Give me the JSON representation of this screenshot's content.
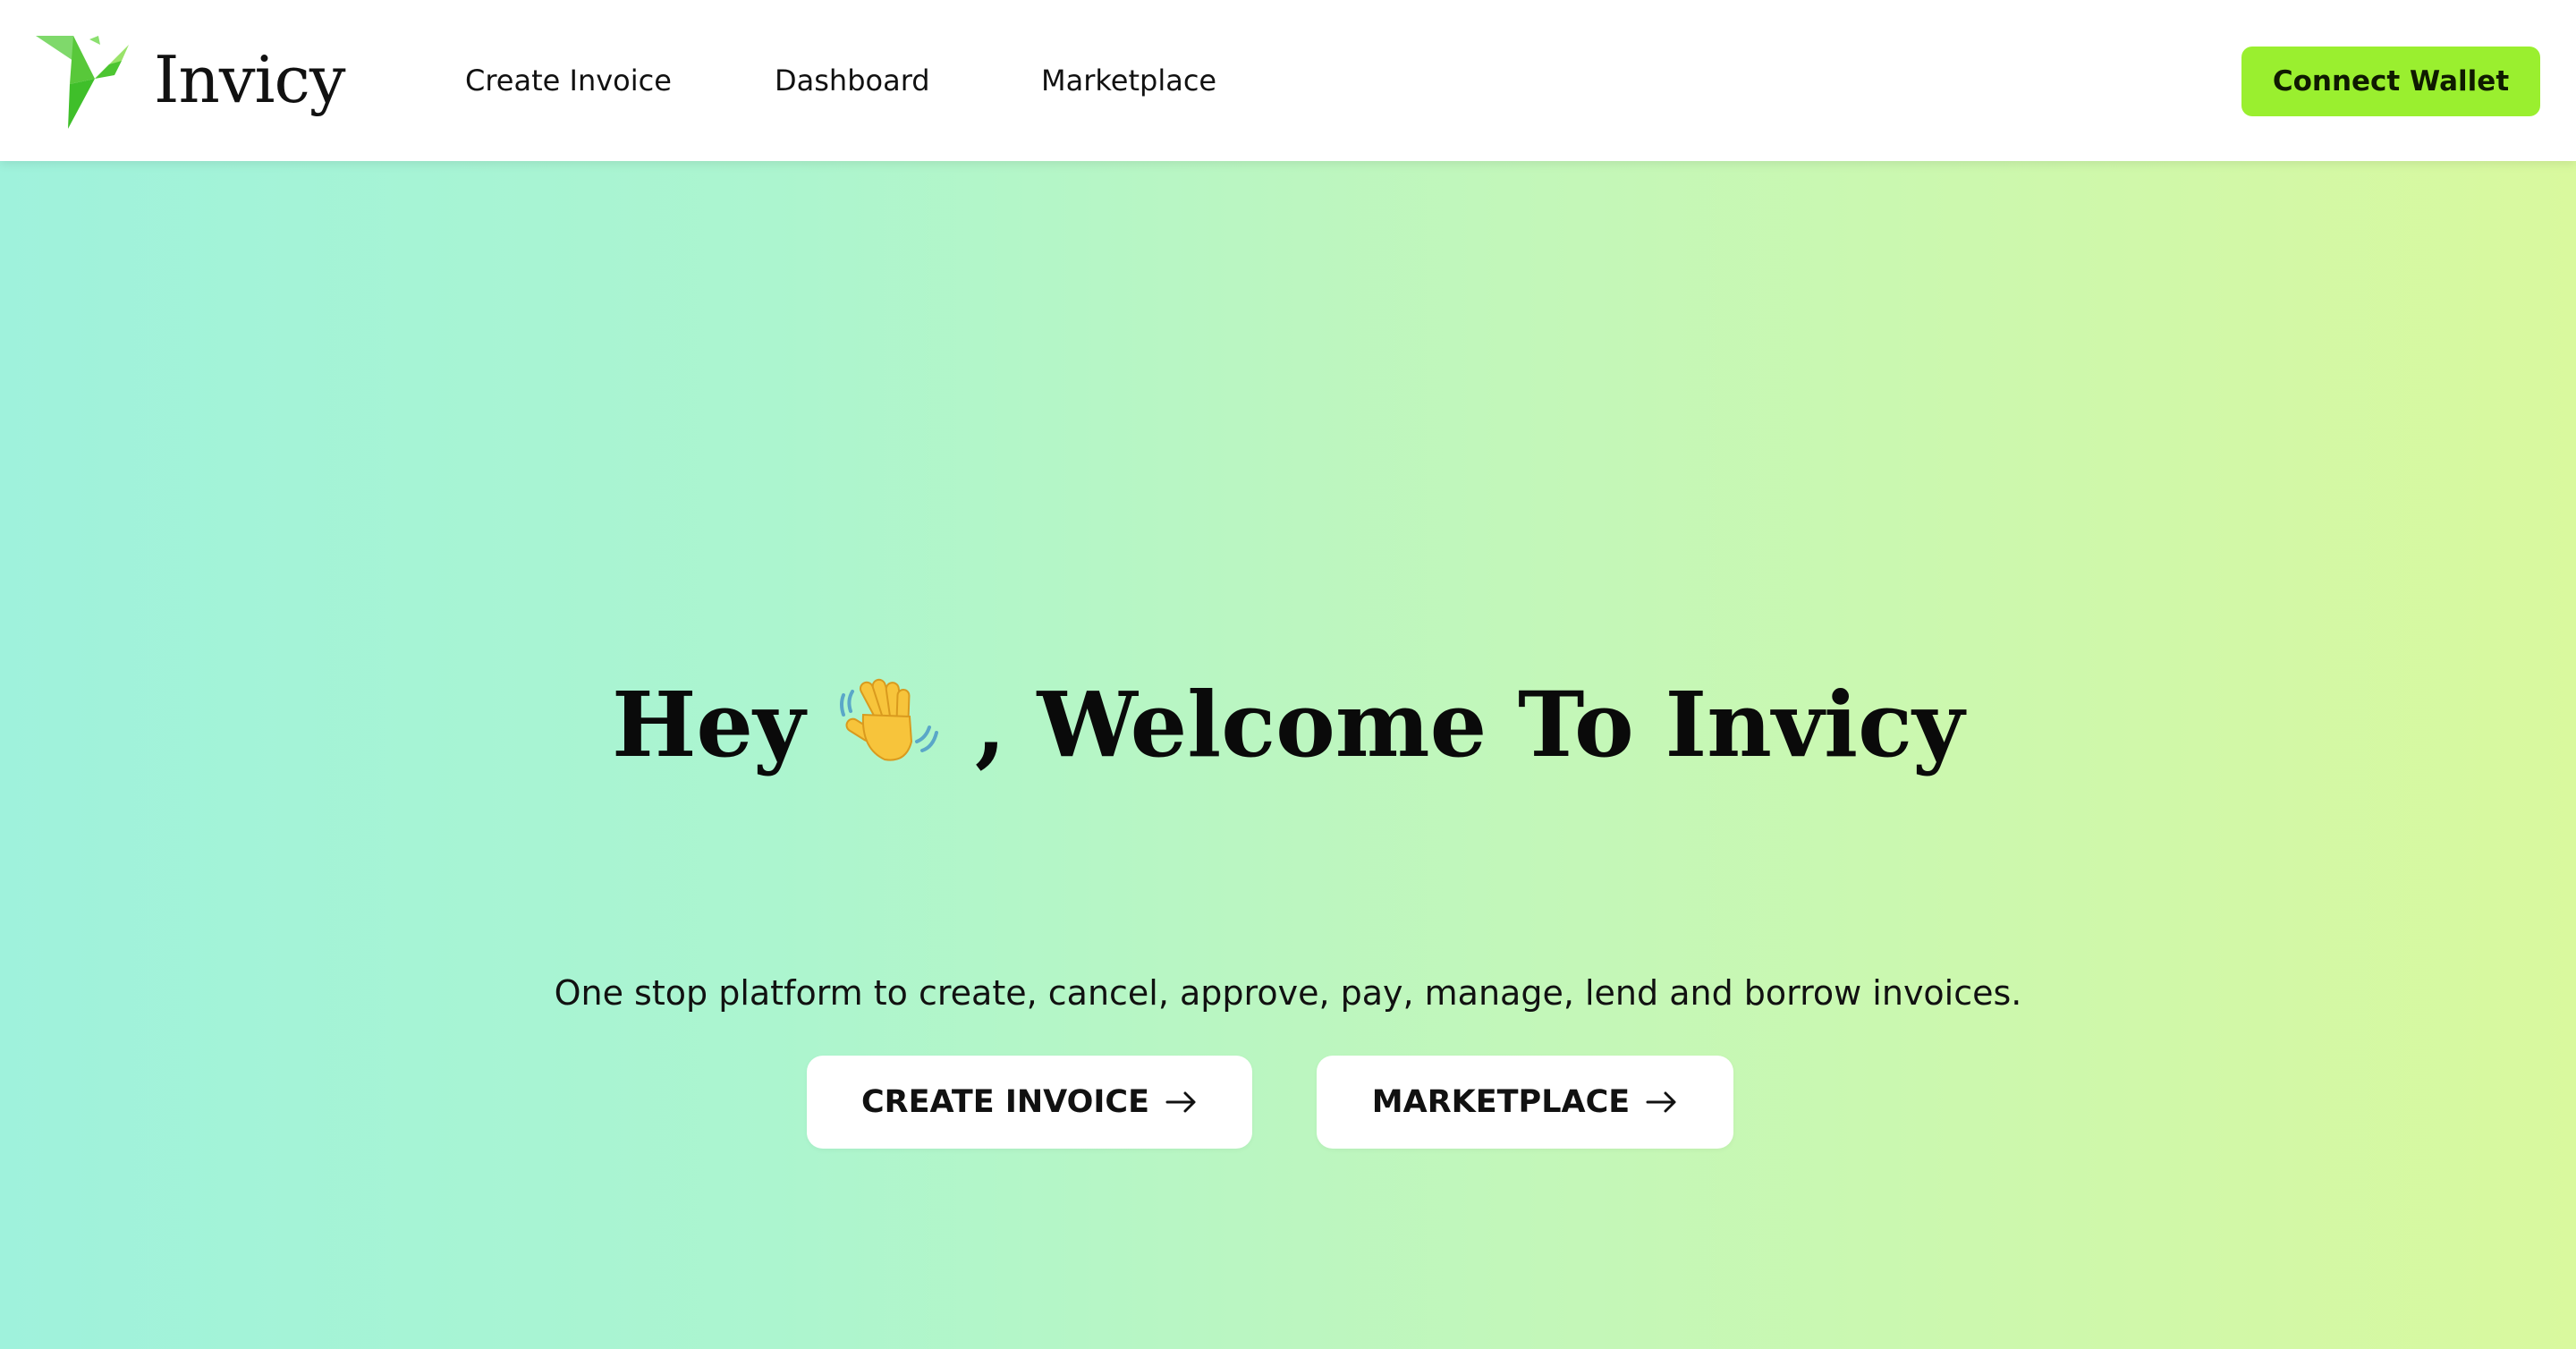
{
  "header": {
    "brand": "Invicy",
    "nav": [
      {
        "label": "Create Invoice"
      },
      {
        "label": "Dashboard"
      },
      {
        "label": "Marketplace"
      }
    ],
    "connect_wallet_label": "Connect Wallet"
  },
  "hero": {
    "title_before": "Hey",
    "title_emoji_icon": "waving-hand-icon",
    "title_after": ", Welcome To Invicy",
    "subtitle": "One stop platform to create, cancel, approve, pay, manage, lend and borrow invoices.",
    "buttons": [
      {
        "label": "CREATE INVOICE",
        "icon": "arrow-right-icon"
      },
      {
        "label": "MARKETPLACE",
        "icon": "arrow-right-icon"
      }
    ]
  },
  "colors": {
    "accent": "#9aef2f",
    "gradient_start": "#9ff2dc",
    "gradient_end": "#d9f99e",
    "logo_green": "#6dd629"
  }
}
